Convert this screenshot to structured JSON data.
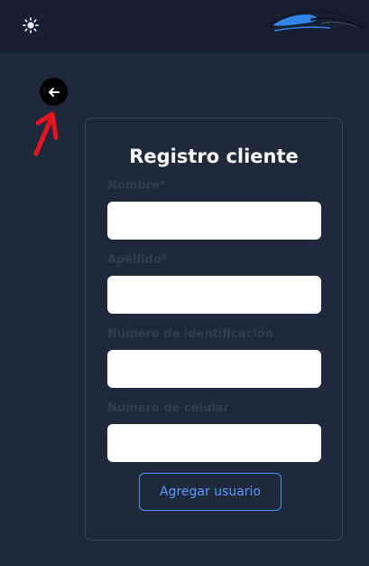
{
  "form": {
    "title": "Registro cliente",
    "fields": [
      {
        "label": "Nombre*",
        "value": ""
      },
      {
        "label": "Apellido*",
        "value": ""
      },
      {
        "label": "Numero de identificación",
        "value": ""
      },
      {
        "label": "Numero de celular",
        "value": ""
      }
    ],
    "submit_label": "Agregar usuario"
  },
  "icons": {
    "theme": "sun-icon",
    "back": "arrow-left-icon",
    "logo": "car-logo"
  },
  "colors": {
    "background": "#1e2a3b",
    "topbar": "#162031",
    "accent": "#4a8df5",
    "annotation": "#e8141a"
  }
}
